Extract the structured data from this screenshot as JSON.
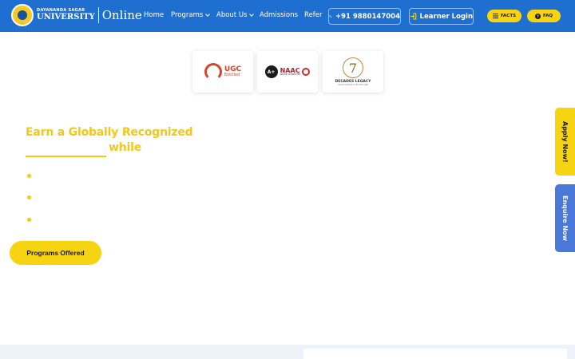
{
  "header": {
    "logo": {
      "line1": "DAYANANDA SAGAR",
      "line2": "UNIVERSITY",
      "brand": "Online"
    },
    "nav": [
      {
        "label": "Home",
        "dropdown": false
      },
      {
        "label": "Programs",
        "dropdown": true
      },
      {
        "label": "About Us",
        "dropdown": true
      },
      {
        "label": "Admissions",
        "dropdown": false
      },
      {
        "label": "Refer",
        "dropdown": false
      }
    ],
    "phone": "+91 9880147004",
    "login": "Learner Login",
    "facts": "FACTS",
    "faq": "FAQ"
  },
  "accreditations": {
    "ugc": {
      "title": "UGC",
      "subtitle": "Entitled"
    },
    "naac": {
      "grade": "A+",
      "title": "NAAC",
      "subtitle": "GRADE ACCREDITED"
    },
    "legacy": {
      "number": "7",
      "title": "DECADES LEGACY",
      "subtitle": "IN EDUCATION & HEALTHCARE"
    }
  },
  "hero": {
    "headline_line1": "Earn a Globally Recognized",
    "headline_line2": "while",
    "cta": "Programs Offered"
  },
  "side_tabs": {
    "apply": "Apply Now!",
    "enquire": "Enquire Now"
  },
  "colors": {
    "nav_blue": "#1f6fd1",
    "accent_yellow": "#f7d412",
    "heading_yellow": "#f2c81a",
    "enquire_blue": "#4a78d8"
  }
}
